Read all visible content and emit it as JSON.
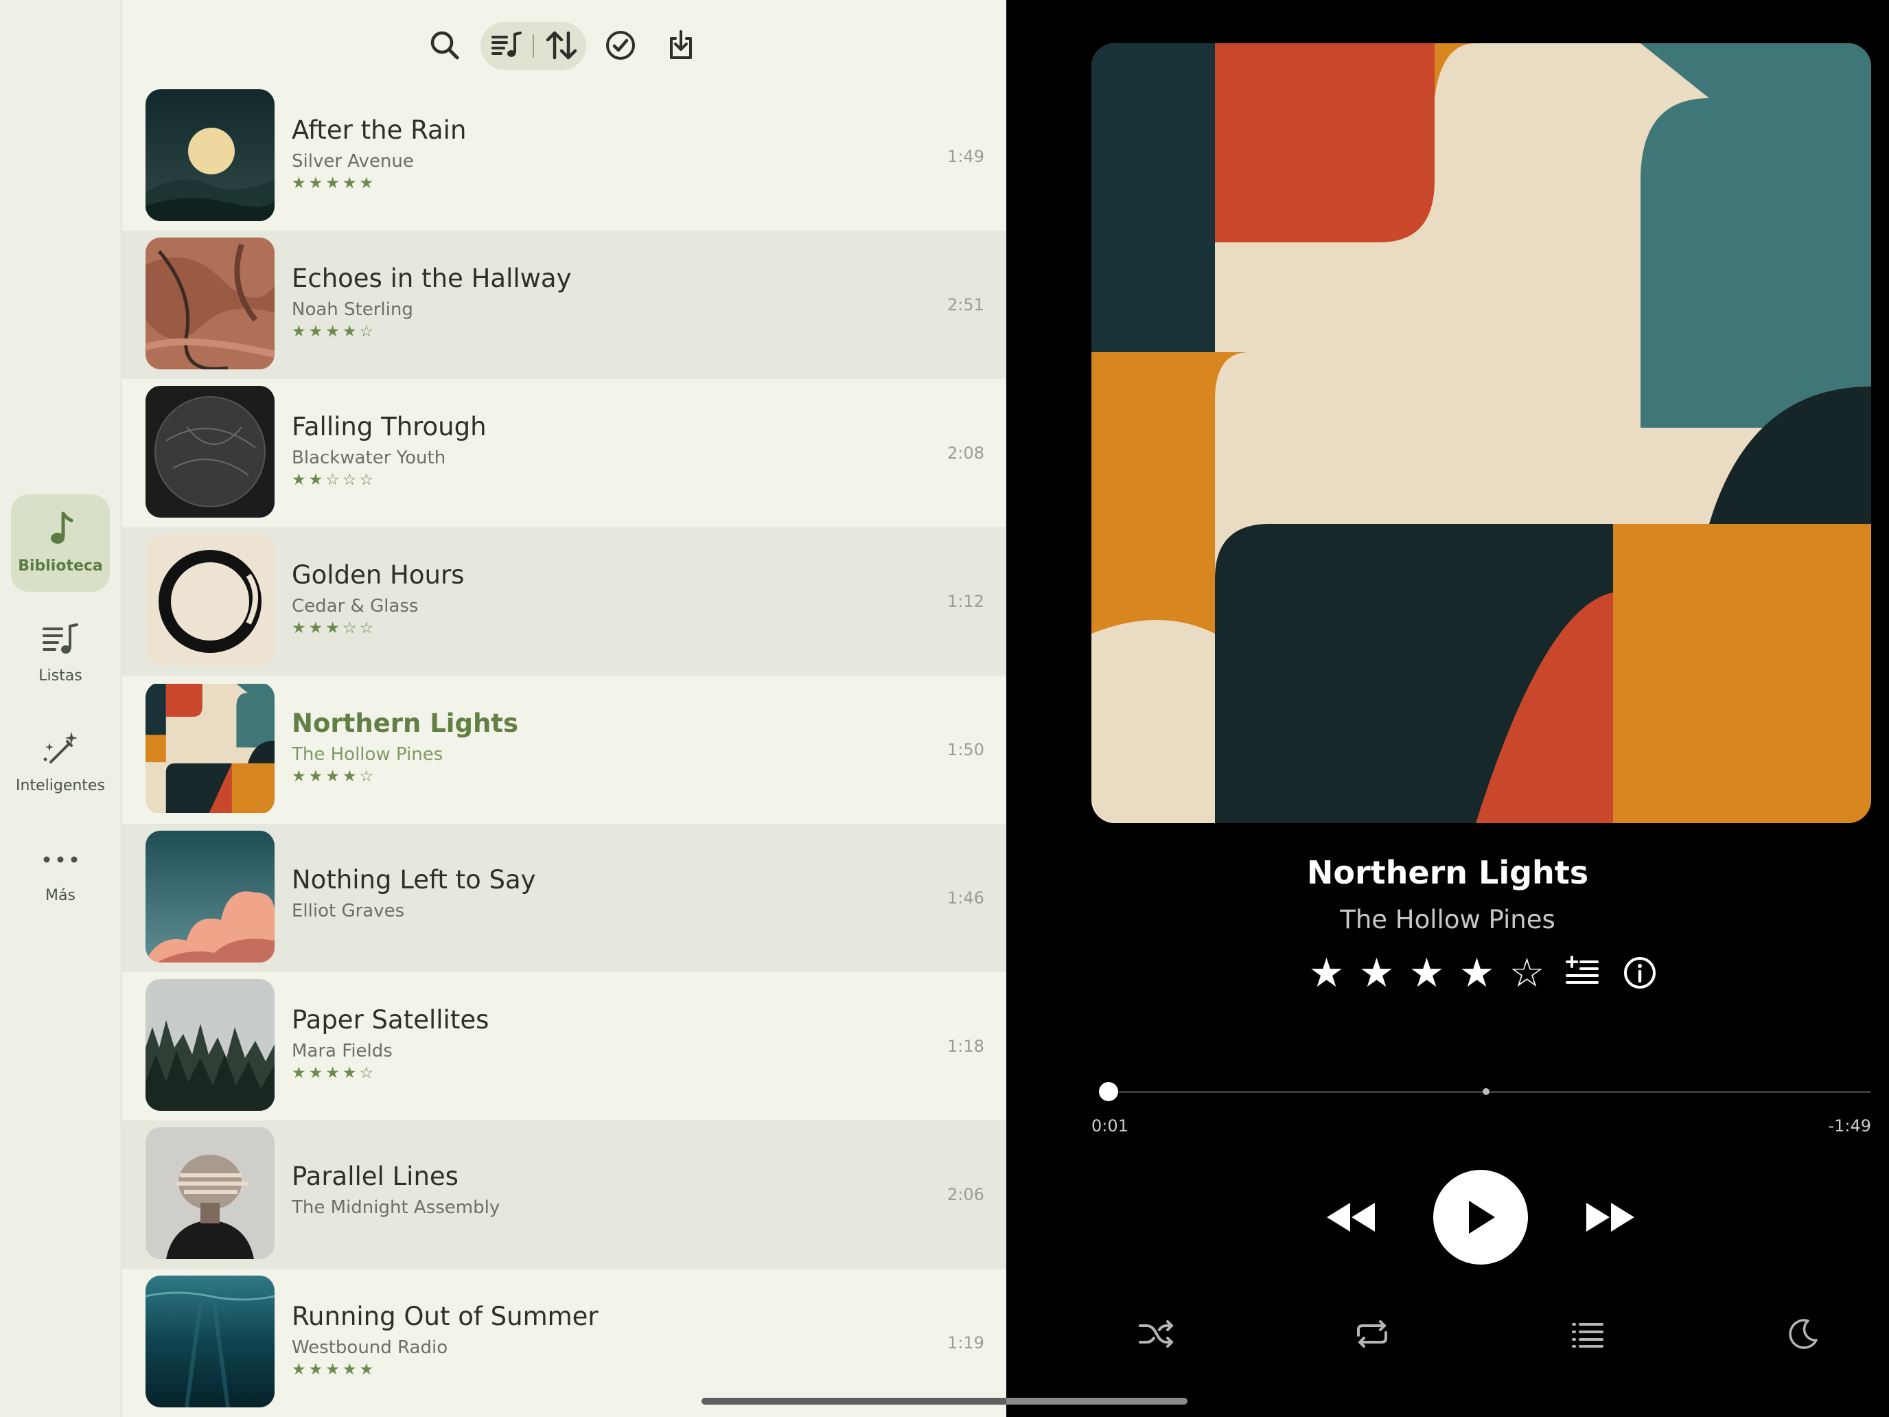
{
  "sidebar": {
    "items": [
      {
        "label": "Biblioteca",
        "icon": "music-note-icon",
        "active": true
      },
      {
        "label": "Listas",
        "icon": "playlist-icon",
        "active": false
      },
      {
        "label": "Inteligentes",
        "icon": "magic-wand-icon",
        "active": false
      },
      {
        "label": "Más",
        "icon": "more-dots-icon",
        "active": false
      }
    ]
  },
  "toolbar": {
    "icons": [
      "search-icon",
      "song-list-icon",
      "sort-icon",
      "select-check-icon",
      "download-icon"
    ]
  },
  "songs": [
    {
      "title": "After the Rain",
      "artist": "Silver Avenue",
      "stars": "★★★★★",
      "rating": 5,
      "duration": "1:49"
    },
    {
      "title": "Echoes in the Hallway",
      "artist": "Noah Sterling",
      "stars": "★★★★☆",
      "rating": 4,
      "duration": "2:51"
    },
    {
      "title": "Falling Through",
      "artist": "Blackwater Youth",
      "stars": "★★☆☆☆",
      "rating": 2,
      "duration": "2:08"
    },
    {
      "title": "Golden Hours",
      "artist": "Cedar & Glass",
      "stars": "★★★☆☆",
      "rating": 3,
      "duration": "1:12"
    },
    {
      "title": "Northern Lights",
      "artist": "The Hollow Pines",
      "stars": "★★★★☆",
      "rating": 4,
      "duration": "1:50",
      "current": true
    },
    {
      "title": "Nothing Left to Say",
      "artist": "Elliot Graves",
      "stars": "",
      "rating": 0,
      "duration": "1:46"
    },
    {
      "title": "Paper Satellites",
      "artist": "Mara Fields",
      "stars": "★★★★☆",
      "rating": 4,
      "duration": "1:18"
    },
    {
      "title": "Parallel Lines",
      "artist": "The Midnight Assembly",
      "stars": "",
      "rating": 0,
      "duration": "2:06"
    },
    {
      "title": "Running Out of Summer",
      "artist": "Westbound Radio",
      "stars": "★★★★★",
      "rating": 5,
      "duration": "1:19"
    }
  ],
  "now_playing": {
    "title": "Northern Lights",
    "artist": "The Hollow Pines",
    "rating": 4,
    "rating_stars": [
      "★",
      "★",
      "★",
      "★",
      "☆"
    ],
    "elapsed": "0:01",
    "remaining": "-1:49",
    "progress": 0.01
  },
  "colors": {
    "accent": "#627f45",
    "sidebar_bg": "#eff0e5",
    "list_bg": "#f2f3e9",
    "player_bg": "#000000"
  }
}
